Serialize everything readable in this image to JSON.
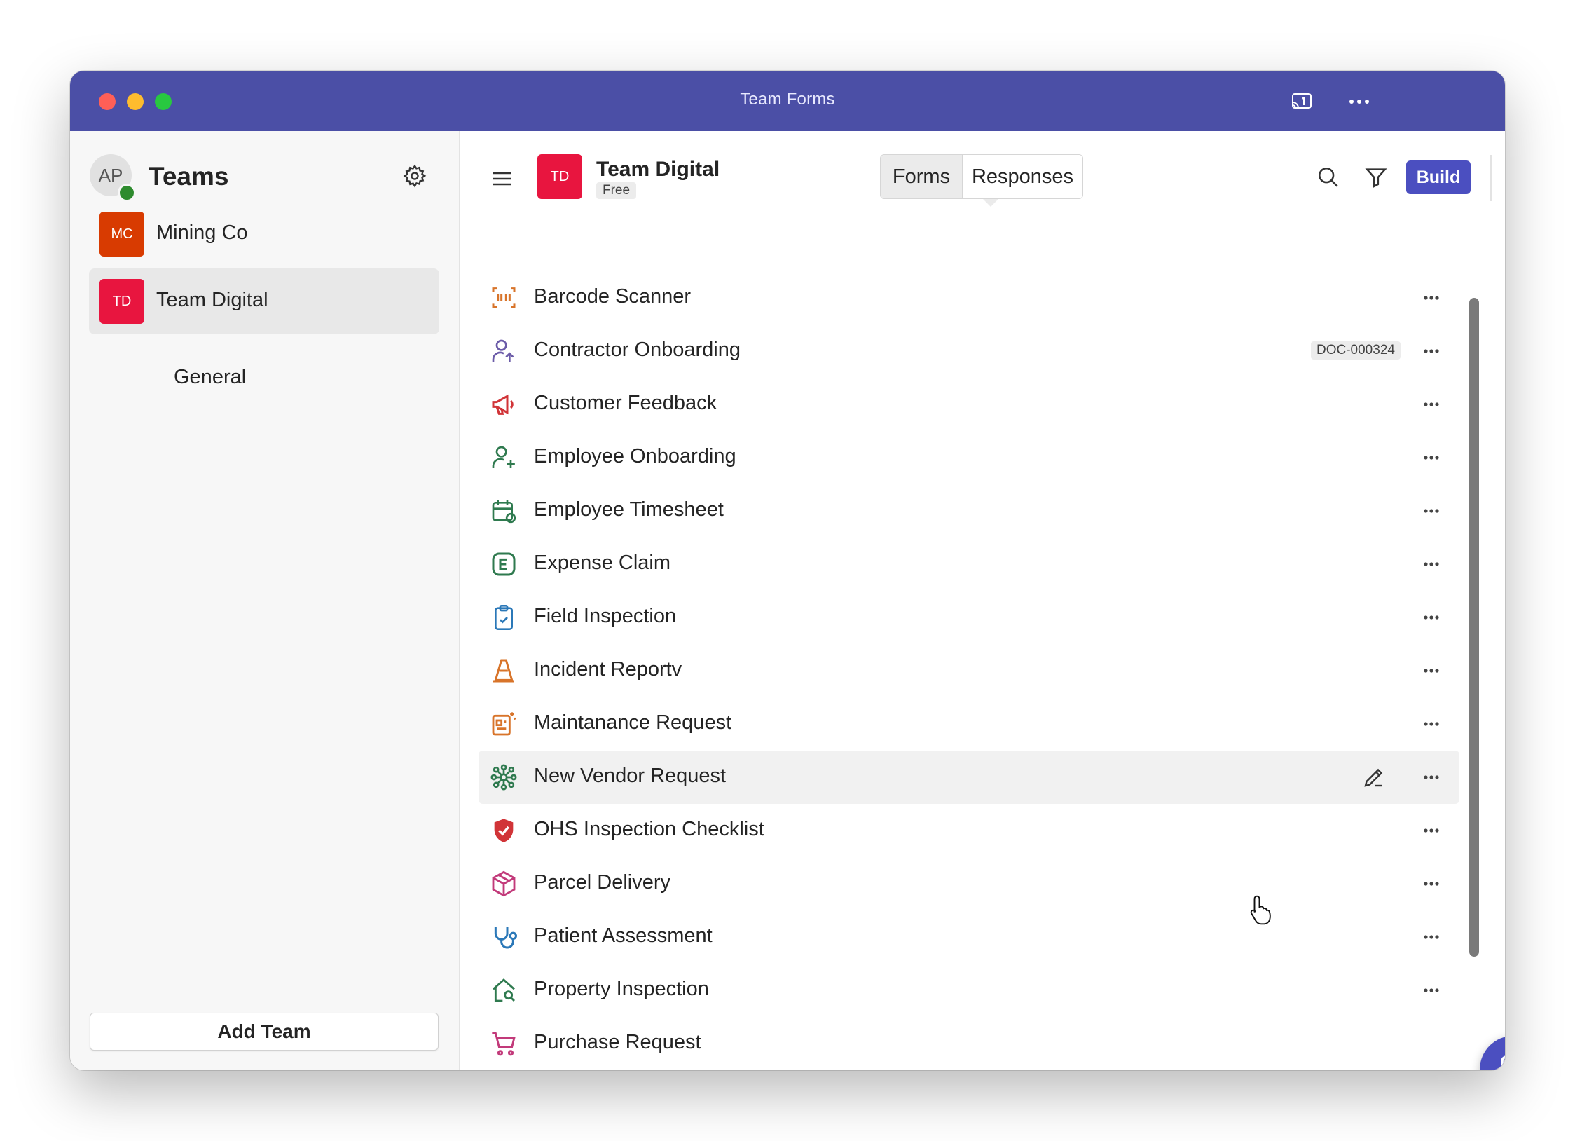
{
  "window": {
    "title": "Team Forms"
  },
  "sidebar": {
    "user_initials": "AP",
    "title": "Teams",
    "teams": [
      {
        "initials": "MC",
        "name": "Mining Co",
        "color": "#d83b01",
        "selected": false
      },
      {
        "initials": "TD",
        "name": "Team Digital",
        "color": "#e8153f",
        "selected": true
      }
    ],
    "channel": "General",
    "add_team_label": "Add Team"
  },
  "header": {
    "team_initials": "TD",
    "team_name": "Team Digital",
    "plan": "Free",
    "tabs": [
      "Forms",
      "Responses"
    ],
    "active_tab": "Forms",
    "build_label": "Build"
  },
  "forms": [
    {
      "label": "Barcode Scanner",
      "icon": "barcode-scan-icon",
      "color": "#d8742a"
    },
    {
      "label": "Contractor Onboarding",
      "icon": "person-arrow-icon",
      "color": "#6b5ba8",
      "badge": "DOC-000324"
    },
    {
      "label": "Customer Feedback",
      "icon": "megaphone-icon",
      "color": "#d13438"
    },
    {
      "label": "Employee Onboarding",
      "icon": "person-add-icon",
      "color": "#2f7a4f"
    },
    {
      "label": "Employee Timesheet",
      "icon": "calendar-clock-icon",
      "color": "#2f7a4f"
    },
    {
      "label": "Expense Claim",
      "icon": "letter-e-icon",
      "color": "#2f7a4f"
    },
    {
      "label": "Field Inspection",
      "icon": "clipboard-check-icon",
      "color": "#2b78b8"
    },
    {
      "label": "Incident Reportv",
      "icon": "traffic-cone-icon",
      "color": "#d8742a"
    },
    {
      "label": "Maintanance Request",
      "icon": "document-sparkle-icon",
      "color": "#d8742a"
    },
    {
      "label": "New Vendor Request",
      "icon": "network-icon",
      "color": "#2f7a4f",
      "hovered": true
    },
    {
      "label": "OHS Inspection Checklist",
      "icon": "shield-check-icon",
      "color": "#d13438"
    },
    {
      "label": "Parcel Delivery",
      "icon": "box-icon",
      "color": "#c23a7a"
    },
    {
      "label": "Patient Assessment",
      "icon": "stethoscope-icon",
      "color": "#2b78b8"
    },
    {
      "label": "Property Inspection",
      "icon": "home-search-icon",
      "color": "#2f7a4f"
    },
    {
      "label": "Purchase Request",
      "icon": "cart-icon",
      "color": "#c23a7a"
    }
  ],
  "colors": {
    "titlebar": "#4b4fa6",
    "accent": "#4b4fc0"
  }
}
